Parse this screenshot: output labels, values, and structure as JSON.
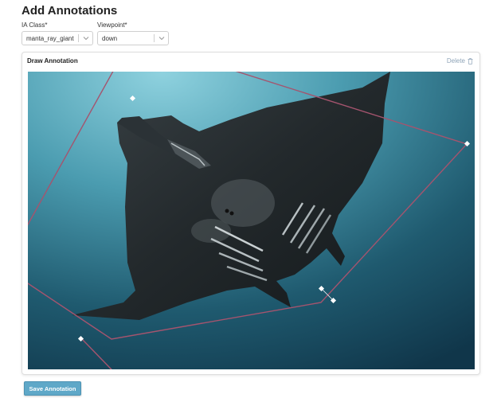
{
  "page": {
    "title": "Add Annotations"
  },
  "form": {
    "ia_class": {
      "label": "IA Class*",
      "value": "manta_ray_giant"
    },
    "viewpoint": {
      "label": "Viewpoint*",
      "value": "down"
    }
  },
  "annotation_card": {
    "title": "Draw Annotation",
    "delete_label": "Delete",
    "image_subject": "manta ray underwater",
    "box_color": "#a5546e",
    "handle_color": "#ffffff"
  },
  "actions": {
    "save_label": "Save Annotation"
  },
  "icons": {
    "chevron": "chevron-down-icon",
    "trash": "trash-icon"
  }
}
